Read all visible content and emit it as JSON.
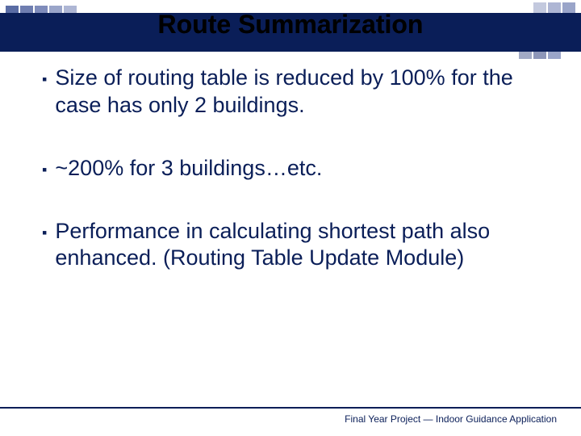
{
  "title": "Route Summarization",
  "bullets": [
    "Size of routing table is reduced by 100% for the case has only 2 buildings.",
    "~200% for 3 buildings…etc.",
    "Performance in calculating shortest path also enhanced. (Routing Table Update Module)"
  ],
  "footer": "Final Year Project — Indoor Guidance Application",
  "bullet_glyph": "▪"
}
